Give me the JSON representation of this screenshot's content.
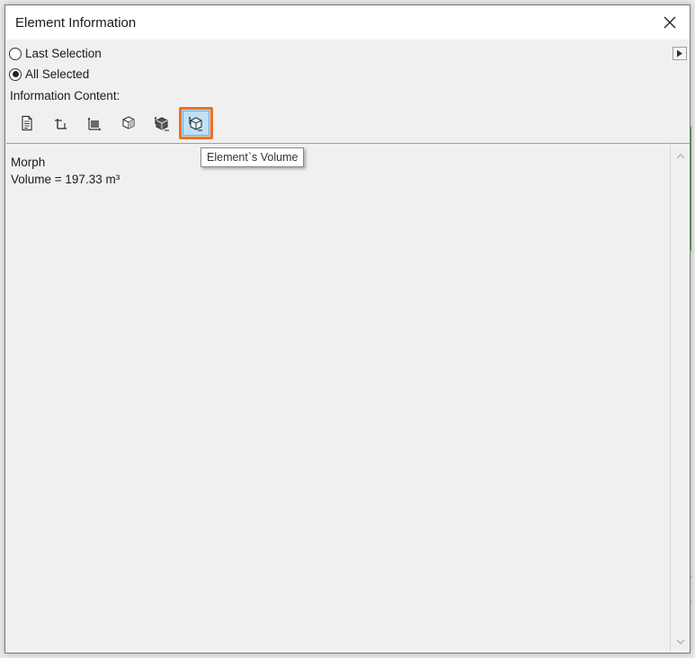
{
  "window": {
    "title": "Element Information"
  },
  "selection": {
    "options": [
      {
        "label": "Last Selection",
        "checked": false
      },
      {
        "label": "All Selected",
        "checked": true
      }
    ]
  },
  "info_content": {
    "label": "Information Content:",
    "tools": [
      {
        "icon": "document-icon"
      },
      {
        "icon": "length-icon"
      },
      {
        "icon": "area-icon"
      },
      {
        "icon": "box-icon"
      },
      {
        "icon": "surface-icon"
      },
      {
        "icon": "volume-icon",
        "active": true
      }
    ],
    "tooltip": "Element`s Volume"
  },
  "result": {
    "element": "Morph",
    "line": "Volume = 197.33 m³"
  },
  "colors": {
    "highlight_border": "#f07020",
    "active_fill": "#bfe0f7"
  }
}
